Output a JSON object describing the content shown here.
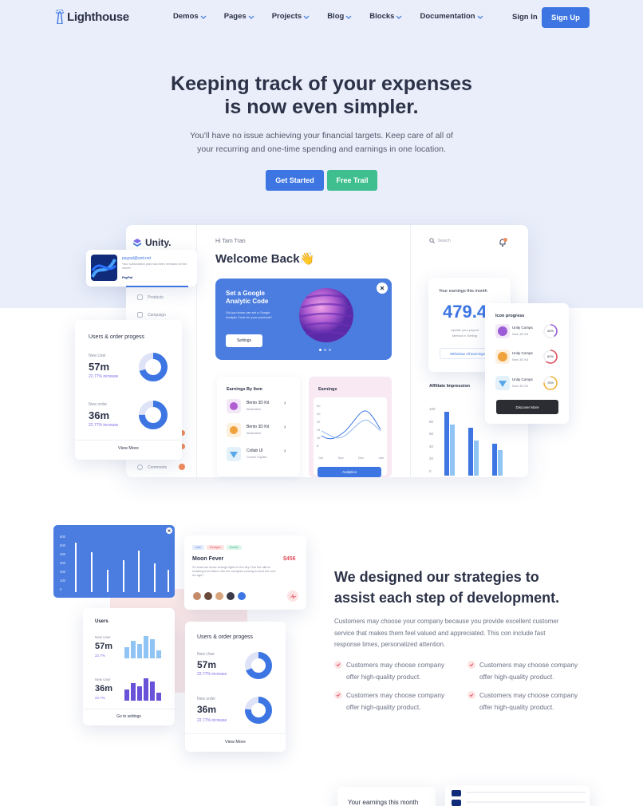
{
  "brand": {
    "logo_text": "Lighthouse",
    "primary": "#3d76e2",
    "success": "#3fbf8f"
  },
  "nav": {
    "items": [
      "Demos",
      "Pages",
      "Projects",
      "Blog",
      "Blocks",
      "Documentation"
    ],
    "signin": "Sign In",
    "signup": "Sign Up"
  },
  "hero": {
    "title_line1": "Keeping track of your expenses",
    "title_line2": "is now even simpler.",
    "sub_line1": "You'll have no issue achieving your financial targets. Keep care of all of",
    "sub_line2": "your recurring and one-time spending and earnings in one location.",
    "cta_primary": "Get Started",
    "cta_secondary": "Free Trail"
  },
  "dashboard": {
    "brand": "Unity.",
    "greeting": "Hi Tam Tran",
    "welcome": "Welcome Back👋",
    "search_placeholder": "Search",
    "sidebar": [
      "Products",
      "Campaign",
      "Comments"
    ],
    "paypal_card": {
      "title": "paypal@unit.net",
      "text": "Your subscription plan has been renewed for the month",
      "tag": "PayPal"
    },
    "banner": {
      "title_line1": "Set a Google",
      "title_line2": "Analytic Code",
      "text": "Did you know can set a Google Analytic Code for your products?",
      "button": "Settings"
    },
    "earnings_by_item": {
      "title": "Earnings By Item",
      "items": [
        {
          "name": "Bento 3D Kit",
          "sub": "Illustration"
        },
        {
          "name": "Bento 3D Kit",
          "sub": "Illustration"
        },
        {
          "name": "Collab UI",
          "sub": "Crowd Toplate"
        }
      ]
    },
    "earnings_chart": {
      "title": "Earnings",
      "yticks": [
        "60",
        "40",
        "32",
        "24",
        "16",
        "8"
      ],
      "xticks": [
        "Oct",
        "Nov",
        "Dec",
        "Jan"
      ],
      "button": "Analytics"
    },
    "your_earnings": {
      "title": "Your earnings this month",
      "value": "479.4",
      "sub_line1": "Update your payout",
      "sub_line2": "Method in Setting",
      "button": "Withdraw All Earnings"
    },
    "affiliate": {
      "title": "Affiliate Impression",
      "yticks": [
        "100",
        "80",
        "60",
        "40",
        "20",
        "0"
      ]
    },
    "icon_progress": {
      "title": "Icon progress",
      "items": [
        {
          "name": "Unity Comps",
          "sub": "New 3D Kit",
          "pct": "40%",
          "color": "#9b5cd6"
        },
        {
          "name": "Unity Comps",
          "sub": "New 3D Kit",
          "pct": "62%",
          "color": "#e0505f"
        },
        {
          "name": "Unity Comps",
          "sub": "New 3D Kit",
          "pct": "75%",
          "color": "#f0b43c"
        }
      ],
      "button": "Discover More"
    },
    "users_orders": {
      "title": "Users & order progess",
      "new_user_label": "New User",
      "new_user_value": "57m",
      "new_user_delta": "22.77% increase",
      "new_order_label": "New order",
      "new_order_value": "36m",
      "new_order_delta": "22.77% increase",
      "button": "View More"
    }
  },
  "section2": {
    "bar_card": {
      "yticks": [
        "600",
        "500",
        "400",
        "300",
        "200",
        "100",
        "0"
      ]
    },
    "task_card": {
      "tags": [
        "Live",
        "Designs",
        "Mobile"
      ],
      "title": "Moon Fever",
      "price": "$456",
      "text": "So what are those strange lights in the sky? Are the aliens invading from Mars? Are the vampires coming to start the next ice age?"
    },
    "users_card": {
      "title": "Users",
      "new_user_label": "New User",
      "value1": "57m",
      "delta1": "22.7%",
      "value2": "36m",
      "delta2": "22.7%",
      "button": "Go to settings"
    },
    "progress_card": {
      "title": "Users & order progess",
      "new_user_label": "New User",
      "new_user_value": "57m",
      "new_user_delta": "22.77% increase",
      "new_order_label": "New order",
      "new_order_value": "36m",
      "new_order_delta": "22.77% increase",
      "button": "View More"
    },
    "title_line1": "We designed our strategies to",
    "title_line2": "assist each step of development.",
    "body_line1": "Customers may choose your company because you provide excellent customer",
    "body_line2": "service that makes them feel valued and appreciated. This con include fast",
    "body_line3": "response times, personalized attention.",
    "features": [
      {
        "line1": "Customers may choose company",
        "line2": "offer high-quality product."
      },
      {
        "line1": "Customers may choose company",
        "line2": "offer high-quality product."
      },
      {
        "line1": "Customers may choose company",
        "line2": "offer high-quality product."
      },
      {
        "line1": "Customers may choose company",
        "line2": "offer high-quality product."
      }
    ]
  },
  "section3": {
    "earnings_title": "Your earnings this month"
  }
}
